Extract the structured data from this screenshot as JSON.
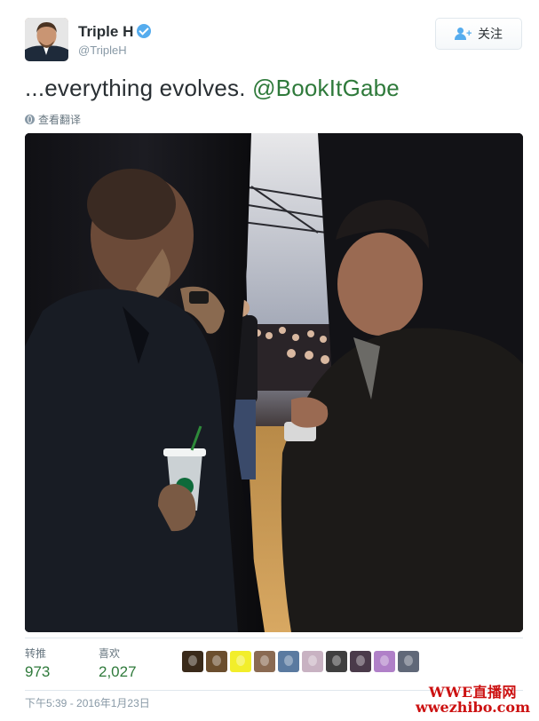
{
  "user": {
    "display_name": "Triple H",
    "handle": "@TripleH",
    "verified_icon": "verified-badge-icon"
  },
  "follow_button": {
    "label": "关注",
    "icon": "add-user-icon"
  },
  "tweet": {
    "text": "...everything evolves. ",
    "mention": "@BookItGabe"
  },
  "translate": {
    "label": "查看翻译",
    "icon": "globe-icon"
  },
  "stats": {
    "retweets_label": "转推",
    "retweets_count": "973",
    "likes_label": "喜欢",
    "likes_count": "2,027"
  },
  "likers": [
    {
      "name": "liker-avatar-1",
      "color": "#3a2a1a"
    },
    {
      "name": "liker-avatar-2",
      "color": "#6b4e2e"
    },
    {
      "name": "liker-avatar-3",
      "color": "#f2ee2a"
    },
    {
      "name": "liker-avatar-4",
      "color": "#8a6a52"
    },
    {
      "name": "liker-avatar-5",
      "color": "#5a7aa0"
    },
    {
      "name": "liker-avatar-6",
      "color": "#c8b2c2"
    },
    {
      "name": "liker-avatar-7",
      "color": "#3f3f3f"
    },
    {
      "name": "liker-avatar-8",
      "color": "#4a3a4a"
    },
    {
      "name": "liker-avatar-9",
      "color": "#b080c8"
    },
    {
      "name": "liker-avatar-10",
      "color": "#606878"
    }
  ],
  "timestamp": "下午5:39 - 2016年1月23日",
  "watermark": {
    "line1": "WWE直播网",
    "line2": "wwezhibo.com"
  },
  "colors": {
    "accent_green": "#2f7a3b",
    "verified_blue": "#55acee",
    "watermark_red": "#cc1111"
  }
}
